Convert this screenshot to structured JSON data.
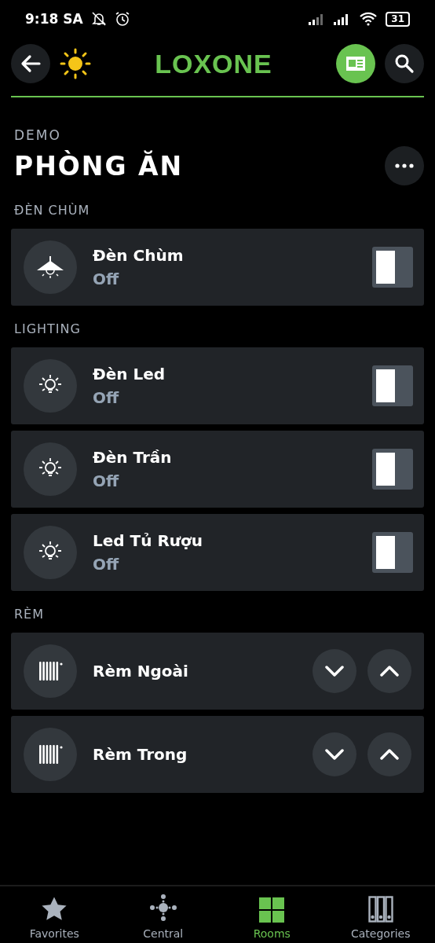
{
  "status_bar": {
    "time": "9:18 SA",
    "battery": "31"
  },
  "header": {
    "logo": "LOXONE"
  },
  "room": {
    "group": "DEMO",
    "title": "PHÒNG ĂN"
  },
  "sections": [
    {
      "title": "ĐÈN CHÙM",
      "items": [
        {
          "kind": "switch",
          "name": "Đèn Chùm",
          "status": "Off",
          "on": false
        }
      ]
    },
    {
      "title": "LIGHTING",
      "items": [
        {
          "kind": "switch",
          "name": "Đèn Led",
          "status": "Off",
          "on": false
        },
        {
          "kind": "switch",
          "name": "Đèn Trần",
          "status": "Off",
          "on": false
        },
        {
          "kind": "switch",
          "name": "Led Tủ Rượu",
          "status": "Off",
          "on": false
        }
      ]
    },
    {
      "title": "RÈM",
      "items": [
        {
          "kind": "blind",
          "name": "Rèm Ngoài"
        },
        {
          "kind": "blind",
          "name": "Rèm Trong"
        }
      ]
    }
  ],
  "tabs": [
    {
      "label": "Favorites",
      "selected": false
    },
    {
      "label": "Central",
      "selected": false
    },
    {
      "label": "Rooms",
      "selected": true
    },
    {
      "label": "Categories",
      "selected": false
    }
  ]
}
